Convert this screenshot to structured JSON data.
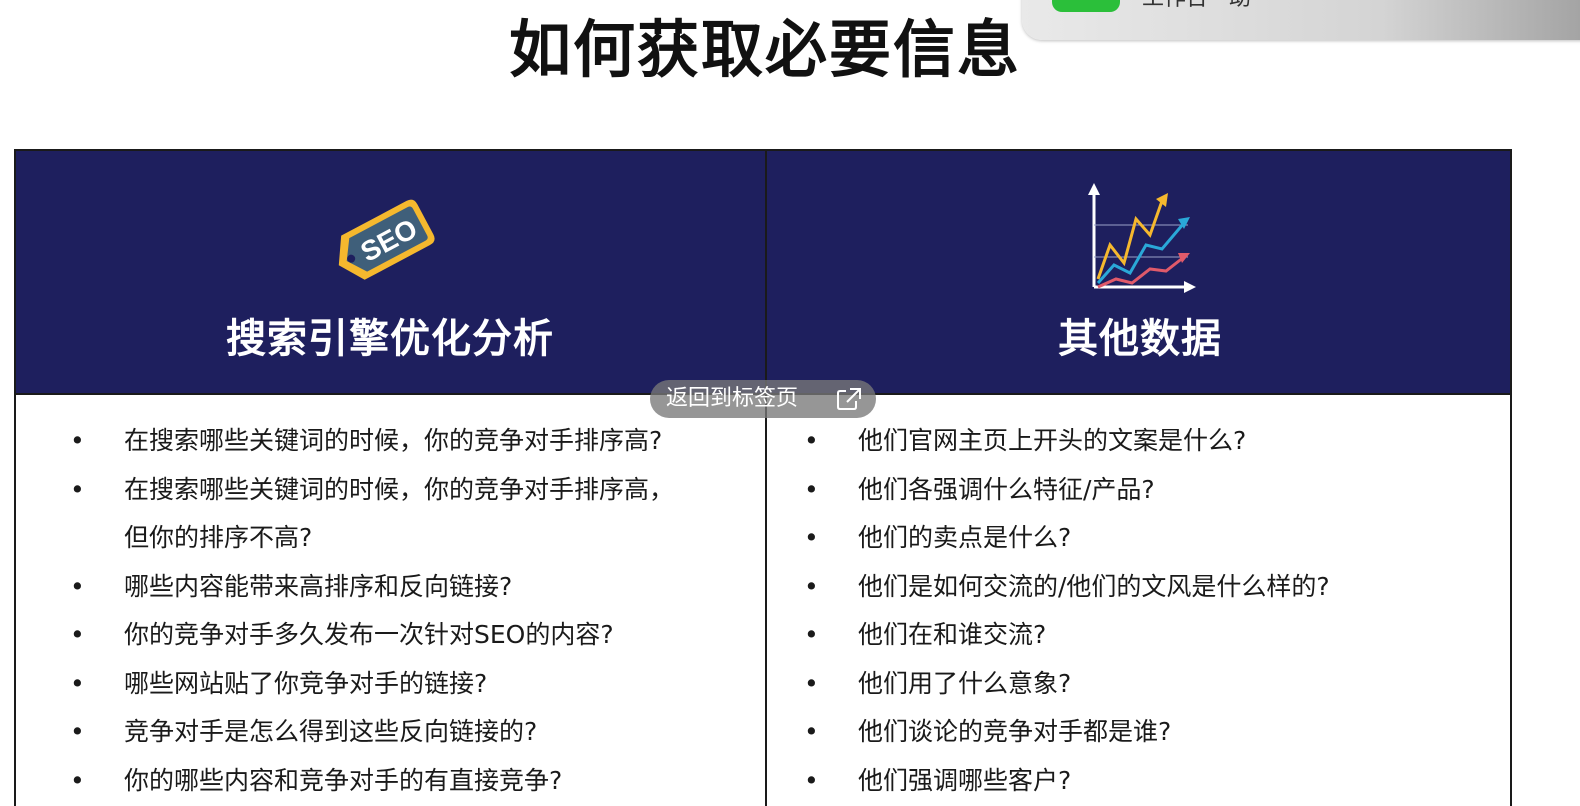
{
  "title": "如何获取必要信息",
  "notification": {
    "text": "工作台 · 助"
  },
  "columns": [
    {
      "icon": "seo-tag-icon",
      "icon_text": "SEO",
      "heading": "搜索引擎优化分析",
      "items": [
        "在搜索哪些关键词的时候，你的竞争对手排序高?",
        "在搜索哪些关键词的时候，你的竞争对手排序高，",
        "但你的排序不高?",
        "哪些内容能带来高排序和反向链接?",
        "你的竞争对手多久发布一次针对SEO的内容?",
        "哪些网站贴了你竞争对手的链接?",
        "竞争对手是怎么得到这些反向链接的?",
        "你的哪些内容和竞争对手的有直接竞争?"
      ]
    },
    {
      "icon": "trend-chart-icon",
      "heading": "其他数据",
      "items": [
        "他们官网主页上开头的文案是什么?",
        "他们各强调什么特征/产品?",
        "他们的卖点是什么?",
        "他们是如何交流的/他们的文风是什么样的?",
        "他们在和谁交流?",
        "他们用了什么意象?",
        "他们谈论的竞争对手都是谁?",
        "他们强调哪些客户?"
      ]
    }
  ],
  "overlay": {
    "label": "返回到标签页",
    "icon": "open-external-icon"
  },
  "colors": {
    "header_bg": "#1e1f5e",
    "tag_gold": "#f5b82e",
    "tag_inner": "#3f5f7a"
  }
}
